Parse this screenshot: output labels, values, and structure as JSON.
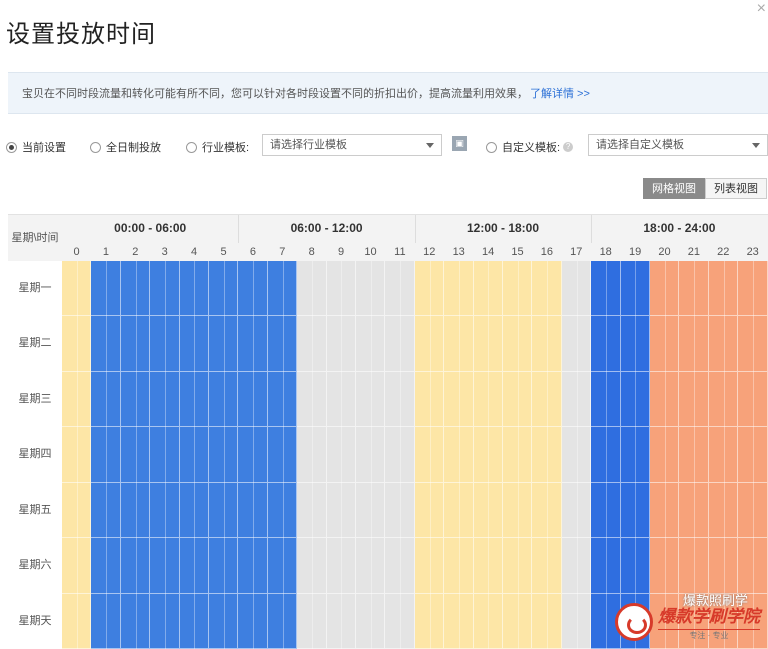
{
  "dialog": {
    "title": "设置投放时间",
    "close_label": "×"
  },
  "notice": {
    "text": "宝贝在不同时段流量和转化可能有所不同，您可以针对各时段设置不同的折扣出价，提高流量利用效果，",
    "link": "了解详情 >>"
  },
  "options": {
    "current": "当前设置",
    "all_day": "全日制投放",
    "industry": "行业模板:",
    "industry_placeholder": "请选择行业模板",
    "custom": "自定义模板:",
    "custom_placeholder": "请选择自定义模板",
    "square_icon": "保存"
  },
  "views": {
    "grid": "网格视图",
    "list": "列表视图"
  },
  "grid": {
    "corner": "星期\\时间",
    "ranges": [
      "00:00 - 06:00",
      "06:00 - 12:00",
      "12:00 - 18:00",
      "18:00 - 24:00"
    ],
    "hours": [
      "0",
      "1",
      "2",
      "3",
      "4",
      "5",
      "6",
      "7",
      "8",
      "9",
      "10",
      "11",
      "12",
      "13",
      "14",
      "15",
      "16",
      "17",
      "18",
      "19",
      "20",
      "21",
      "22",
      "23"
    ],
    "days": [
      "星期一",
      "星期二",
      "星期三",
      "星期四",
      "星期五",
      "星期六",
      "星期天"
    ],
    "hour_colors": [
      "#fde6a6",
      "#3e7fe0",
      "#3e7fe0",
      "#3e7fe0",
      "#3e7fe0",
      "#3e7fe0",
      "#3e7fe0",
      "#3e7fe0",
      "#e4e4e4",
      "#e4e4e4",
      "#e4e4e4",
      "#e4e4e4",
      "#fde6a6",
      "#fde6a6",
      "#fde6a6",
      "#fde6a6",
      "#fde6a6",
      "#e4e4e4",
      "#2f6ee0",
      "#2f6ee0",
      "#f7a27a",
      "#f7a27a",
      "#f7a27a",
      "#f7a27a"
    ]
  },
  "watermark": {
    "top": "爆款照刷学",
    "main": "爆款学刷学院",
    "sub": "专注 · 专业"
  }
}
